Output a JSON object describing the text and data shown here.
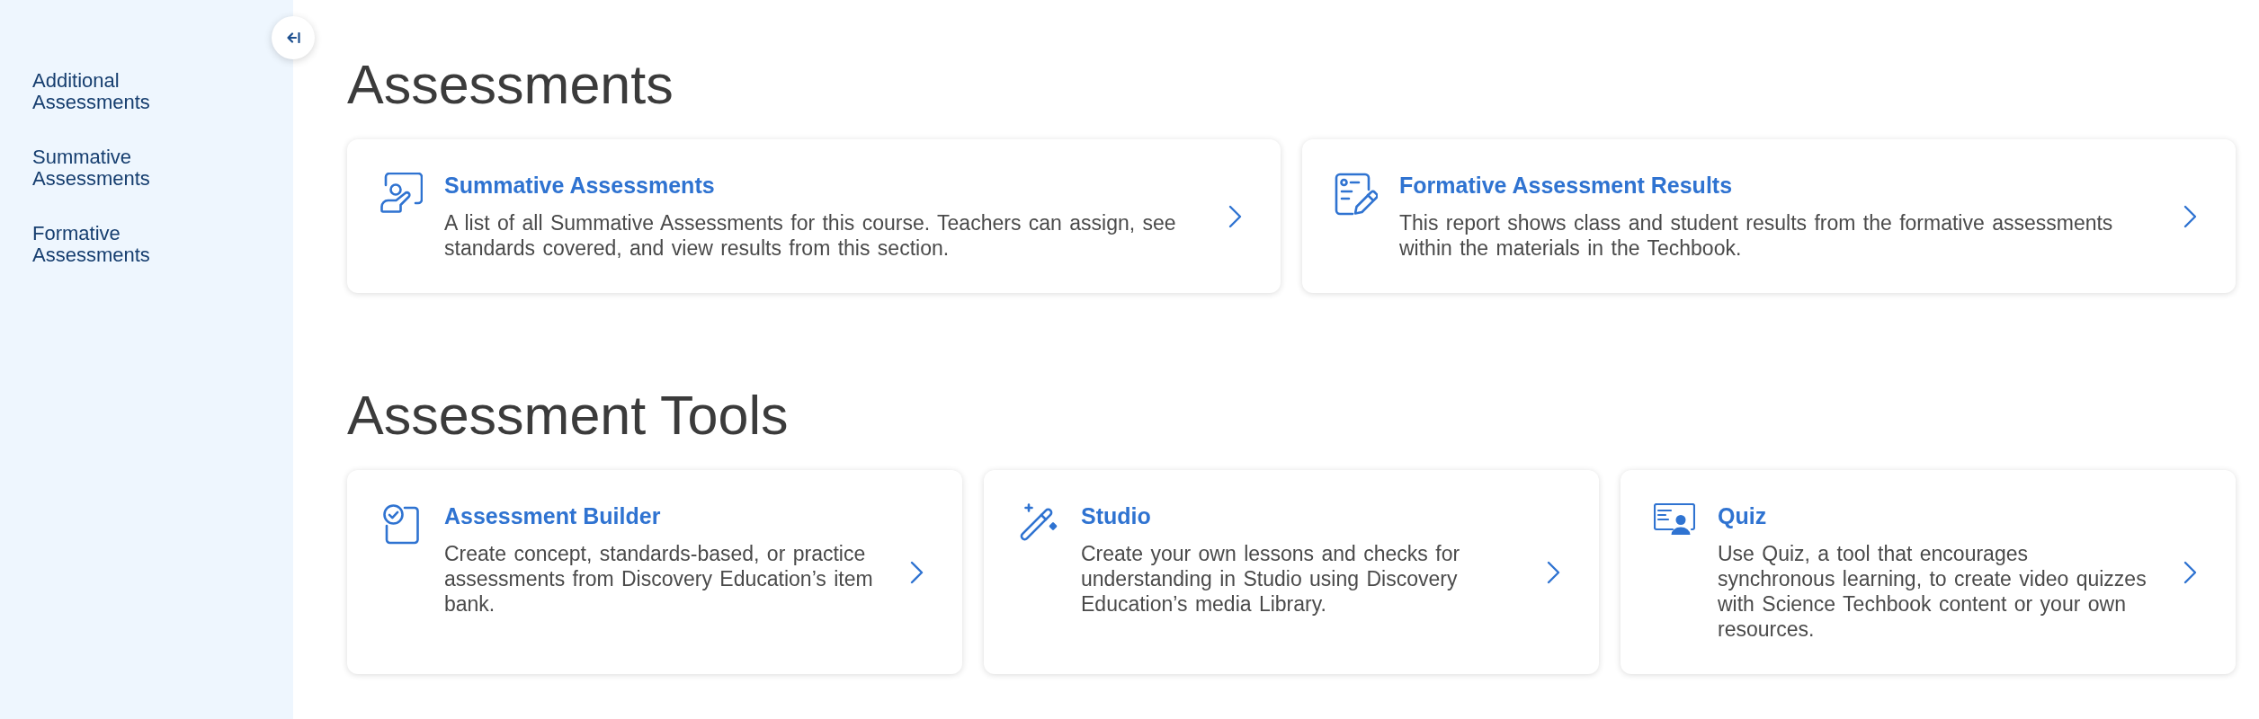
{
  "sidebar": {
    "items": [
      {
        "label": "Additional Assessments"
      },
      {
        "label": "Summative Assessments"
      },
      {
        "label": "Formative Assessments"
      }
    ]
  },
  "sections": [
    {
      "title": "Assessments",
      "cards": [
        {
          "kind": "summative",
          "title": "Summative Assessments",
          "description": "A list of all Summative Assessments for this course. Teachers can assign, see standards covered, and view results from this section."
        },
        {
          "kind": "formative",
          "title": "Formative Assessment Results",
          "description": "This report shows class and student results from the formative assessments within the materials in the Techbook."
        }
      ]
    },
    {
      "title": "Assessment Tools",
      "cards": [
        {
          "kind": "builder",
          "title": "Assessment Builder",
          "description": "Create concept, standards-based, or practice assessments from Discovery Education’s item bank."
        },
        {
          "kind": "studio",
          "title": "Studio",
          "description": "Create your own lessons and checks for understanding in Studio using Discovery Education’s media Library."
        },
        {
          "kind": "quiz",
          "title": "Quiz",
          "description": "Use Quiz, a tool that encourages synchronous learning, to create video quizzes with Science Techbook content or your own resources."
        }
      ]
    }
  ]
}
